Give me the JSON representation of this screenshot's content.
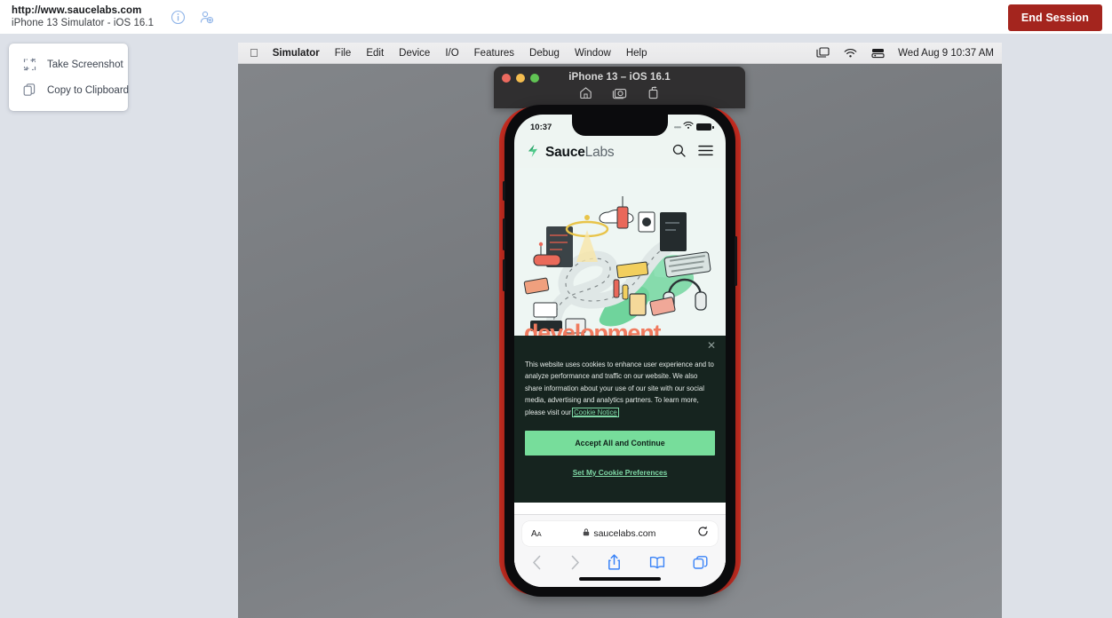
{
  "topbar": {
    "url": "http://www.saucelabs.com",
    "device": "iPhone 13 Simulator - iOS 16.1",
    "info_icon": "info-circle-icon",
    "add_user_icon": "add-user-icon",
    "end_session_label": "End Session",
    "end_session_color": "#a4251e"
  },
  "tool_panel": {
    "items": [
      {
        "label": "Take Screenshot",
        "icon": "crop-plus-icon"
      },
      {
        "label": "Copy to Clipboard",
        "icon": "copy-pages-icon"
      }
    ]
  },
  "menubar": {
    "apple": "\u0010",
    "items": [
      "Simulator",
      "File",
      "Edit",
      "Device",
      "I/O",
      "Features",
      "Debug",
      "Window",
      "Help"
    ],
    "status_icons": [
      "screen-mirroring-icon",
      "wifi-icon",
      "control-center-icon"
    ],
    "clock": "Wed Aug 9  10:37 AM"
  },
  "simulator_window": {
    "title": "iPhone 13 – iOS 16.1",
    "traffic_lights": [
      "close",
      "minimize",
      "zoom"
    ],
    "tools": [
      "home-icon",
      "screenshot-camera-icon",
      "rotate-icon"
    ]
  },
  "phone": {
    "body_color": "#cf2e22",
    "status_bar": {
      "time": "10:37",
      "wifi": "wifi-icon",
      "battery": "battery-icon"
    },
    "site": {
      "brand_bold": "Sauce",
      "brand_light": "Labs",
      "logo_icon": "saucelabs-logo-icon",
      "search_icon": "search-icon",
      "menu_icon": "hamburger-menu-icon",
      "headline": "development",
      "headline_color": "#f07a5e"
    },
    "cookie_banner": {
      "close_icon": "close-icon",
      "text_before_link": "This website uses cookies to enhance user experience and to analyze performance and traffic on our website. We also share information about your use of our site with our social media, advertising and analytics partners. To learn more, please visit our ",
      "link_text": "Cookie Notice",
      "accept_label": "Accept All and Continue",
      "prefs_label": "Set My Cookie Preferences",
      "accept_color": "#77dd9b",
      "background": "#16241f"
    },
    "safari": {
      "text_size_label": "AA",
      "lock_icon": "lock-icon",
      "domain": "saucelabs.com",
      "reload_icon": "reload-icon",
      "toolbar_icons": [
        "back-icon",
        "forward-icon",
        "share-icon",
        "bookmarks-icon",
        "tabs-icon"
      ]
    }
  }
}
